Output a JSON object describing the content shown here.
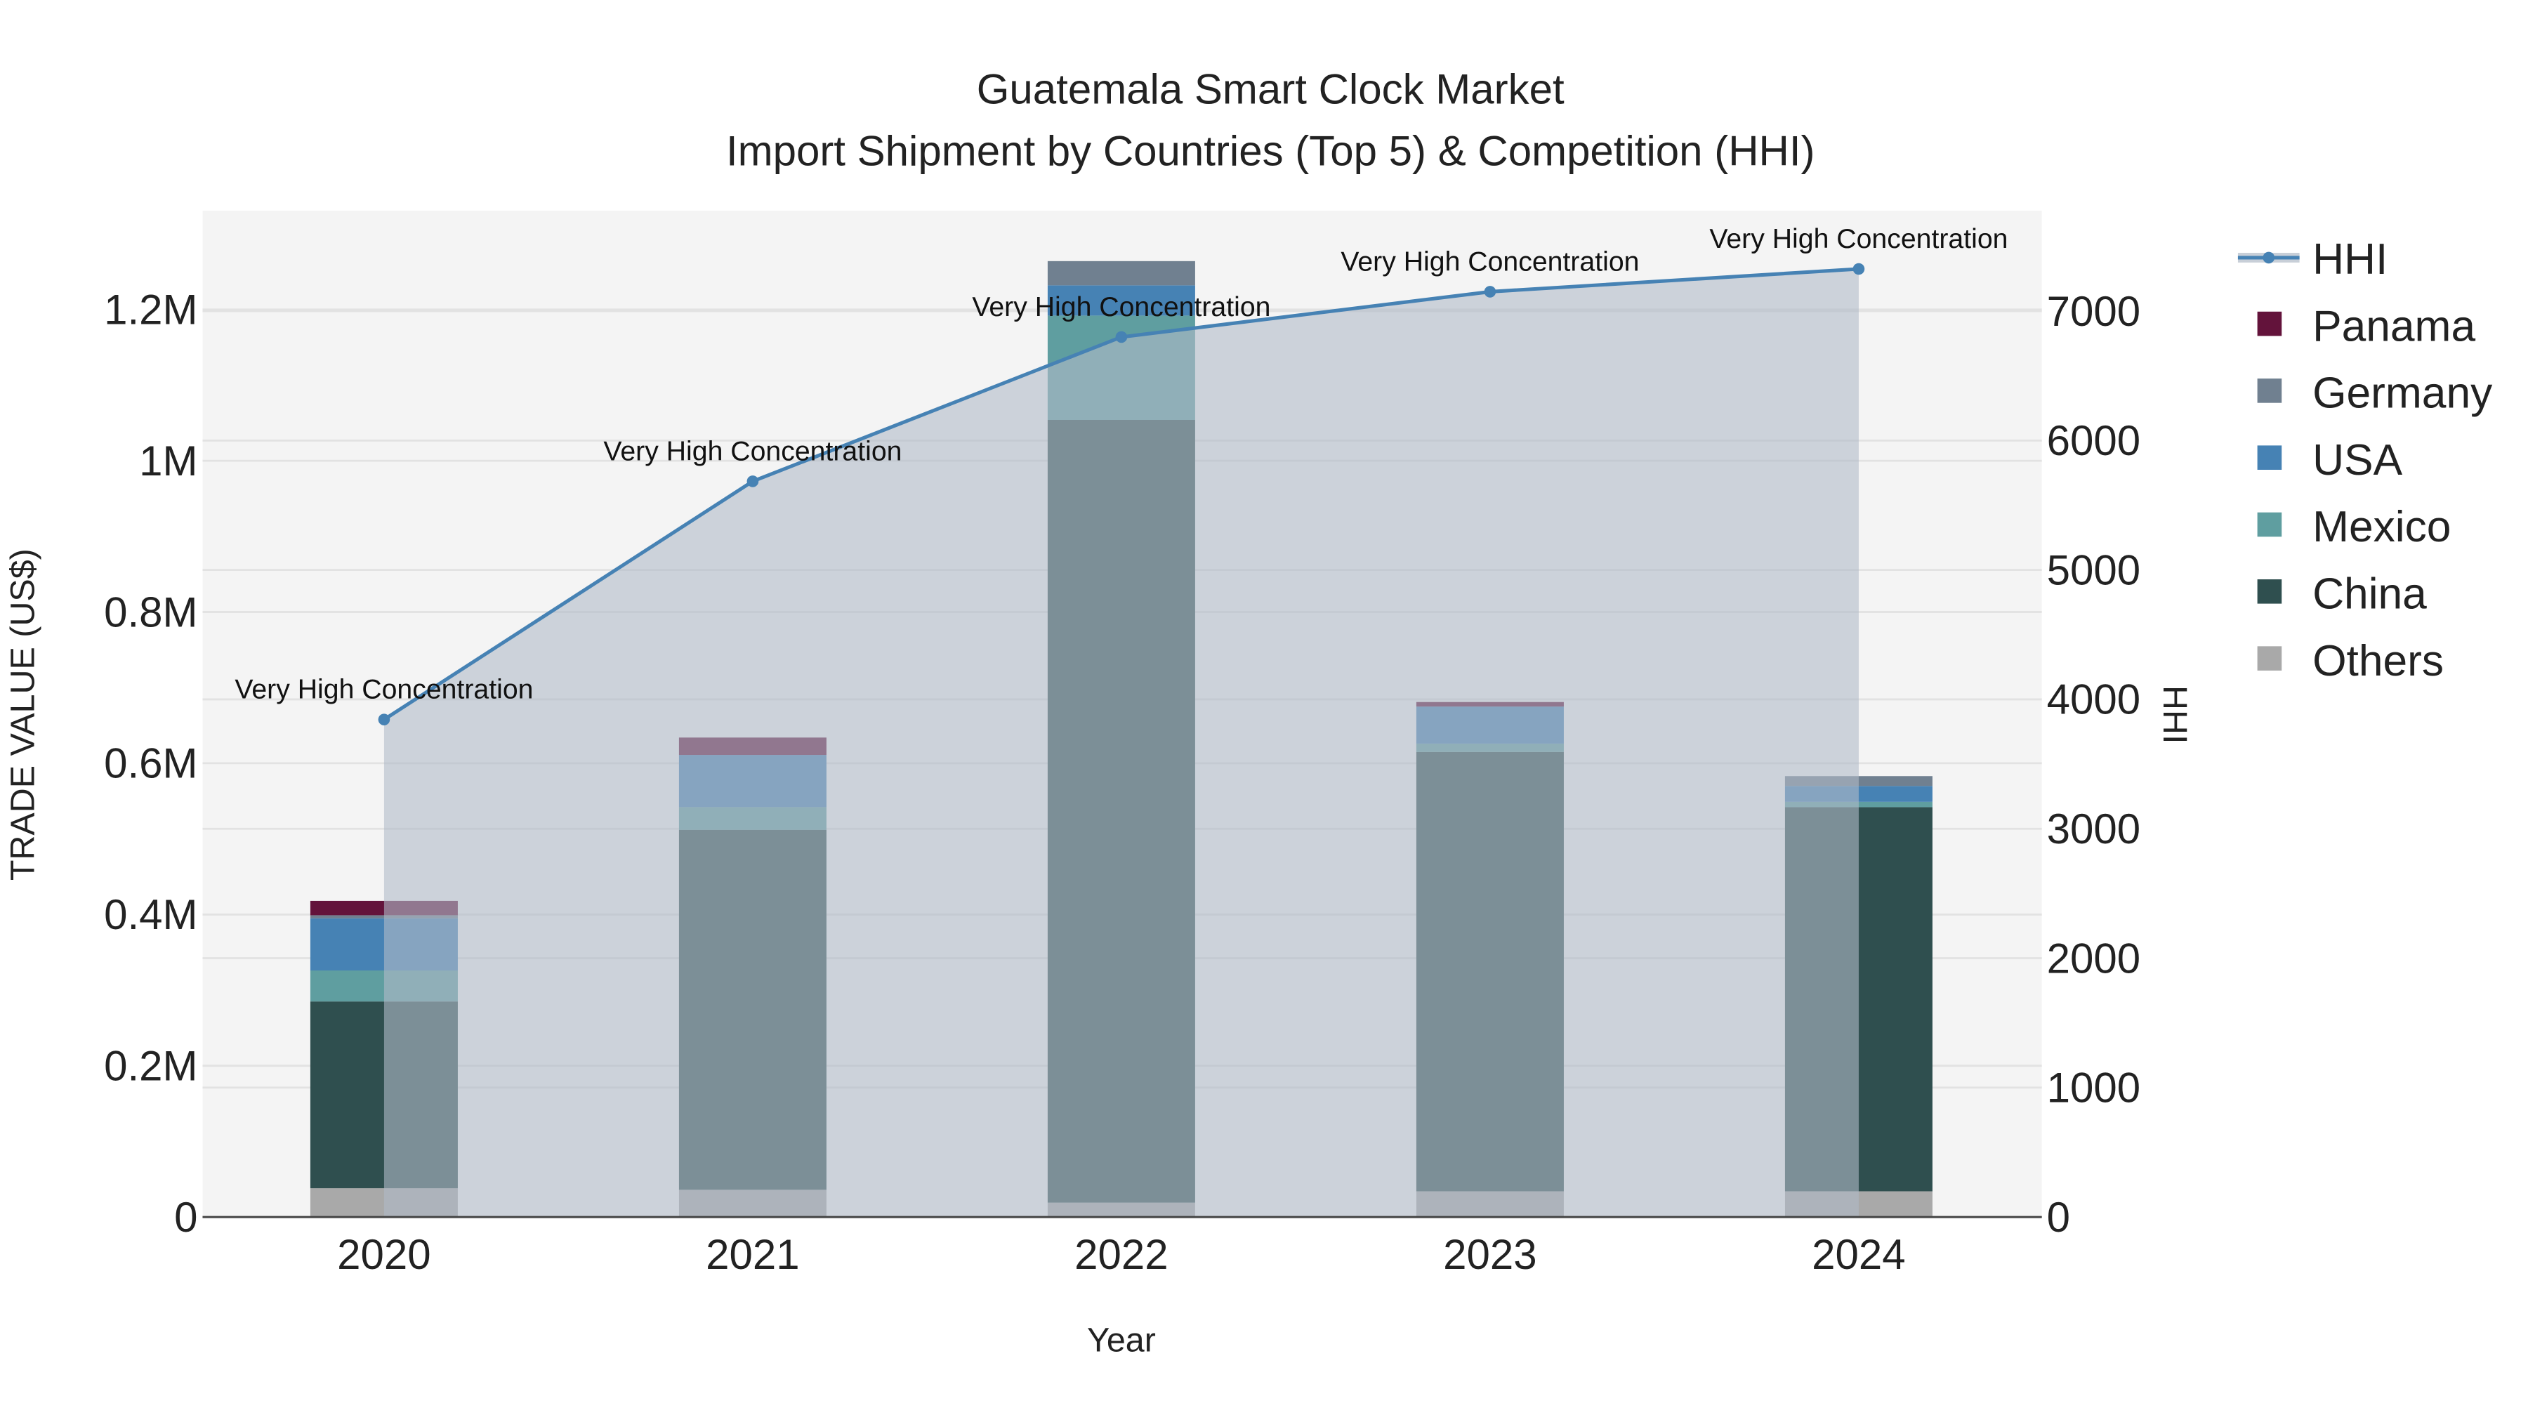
{
  "chart_data": {
    "type": "bar",
    "title": "Guatemala Smart Clock Market",
    "subtitle": "Import Shipment by Countries (Top 5) & Competition (HHI)",
    "xlabel": "Year",
    "ylabel": "TRADE VALUE (US$)",
    "y2label": "HHI",
    "categories": [
      "2020",
      "2021",
      "2022",
      "2023",
      "2024"
    ],
    "ylim": [
      0,
      1320000
    ],
    "y2lim": [
      0,
      7700
    ],
    "yticks": [
      {
        "v": 0,
        "label": "0"
      },
      {
        "v": 200000,
        "label": "0.2M"
      },
      {
        "v": 400000,
        "label": "0.4M"
      },
      {
        "v": 600000,
        "label": "0.6M"
      },
      {
        "v": 800000,
        "label": "0.8M"
      },
      {
        "v": 1000000,
        "label": "1M"
      },
      {
        "v": 1200000,
        "label": "1.2M"
      }
    ],
    "y2ticks": [
      {
        "v": 0,
        "label": "0"
      },
      {
        "v": 1000,
        "label": "1000"
      },
      {
        "v": 2000,
        "label": "2000"
      },
      {
        "v": 3000,
        "label": "3000"
      },
      {
        "v": 4000,
        "label": "4000"
      },
      {
        "v": 5000,
        "label": "5000"
      },
      {
        "v": 6000,
        "label": "6000"
      },
      {
        "v": 7000,
        "label": "7000"
      }
    ],
    "series": [
      {
        "name": "Others",
        "color": "#a9a9a9",
        "values": [
          38000,
          36000,
          19000,
          34000,
          34000
        ]
      },
      {
        "name": "China",
        "color": "#2f4f4f",
        "values": [
          247000,
          476000,
          1035000,
          581000,
          508000
        ]
      },
      {
        "name": "Mexico",
        "color": "#5f9ea0",
        "values": [
          41000,
          30000,
          138000,
          11000,
          7000
        ]
      },
      {
        "name": "USA",
        "color": "#4682b4",
        "values": [
          69000,
          69000,
          40000,
          49000,
          21000
        ]
      },
      {
        "name": "Germany",
        "color": "#708090",
        "values": [
          4000,
          0,
          32000,
          0,
          13000
        ]
      },
      {
        "name": "Panama",
        "color": "#63133b",
        "values": [
          19000,
          23000,
          0,
          6000,
          0
        ]
      }
    ],
    "hhi": {
      "name": "HHI",
      "color": "#4682b4",
      "values": [
        3844,
        5685,
        6800,
        7150,
        7326
      ],
      "annotations": [
        "Very High Concentration",
        "Very High Concentration",
        "Very High Concentration",
        "Very High Concentration",
        "Very High Concentration"
      ]
    },
    "legend": {
      "position": "right",
      "order": [
        "HHI",
        "Panama",
        "Germany",
        "USA",
        "Mexico",
        "China",
        "Others"
      ]
    },
    "grid": true
  }
}
